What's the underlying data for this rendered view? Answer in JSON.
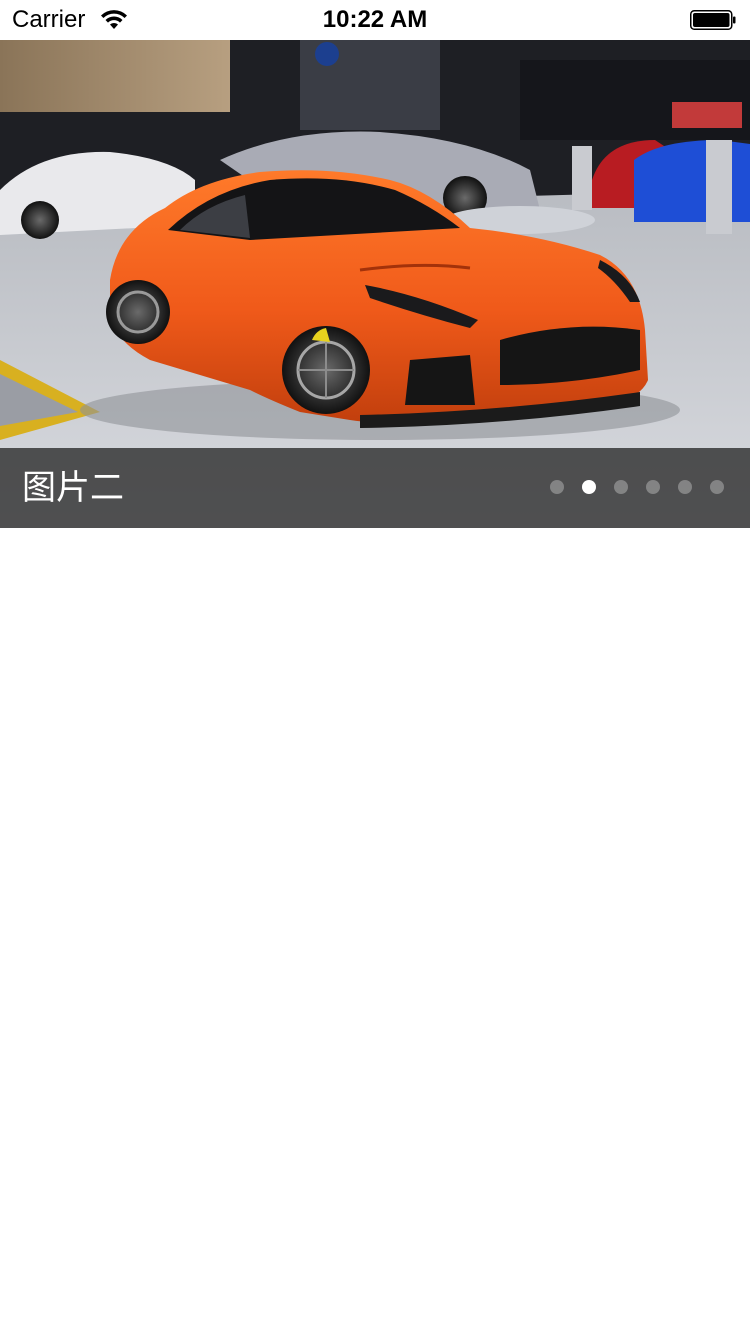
{
  "status_bar": {
    "carrier": "Carrier",
    "time": "10:22 AM",
    "wifi_icon": "wifi-icon",
    "battery_icon": "battery-icon"
  },
  "banner": {
    "caption": "图片二",
    "page_count": 6,
    "current_page": 2,
    "image_subject": "orange sports car at auto show"
  },
  "colors": {
    "car_body": "#f05a1a",
    "caption_overlay": "#282828",
    "dot_active": "#ffffff",
    "dot_inactive": "#8a8a8a"
  }
}
